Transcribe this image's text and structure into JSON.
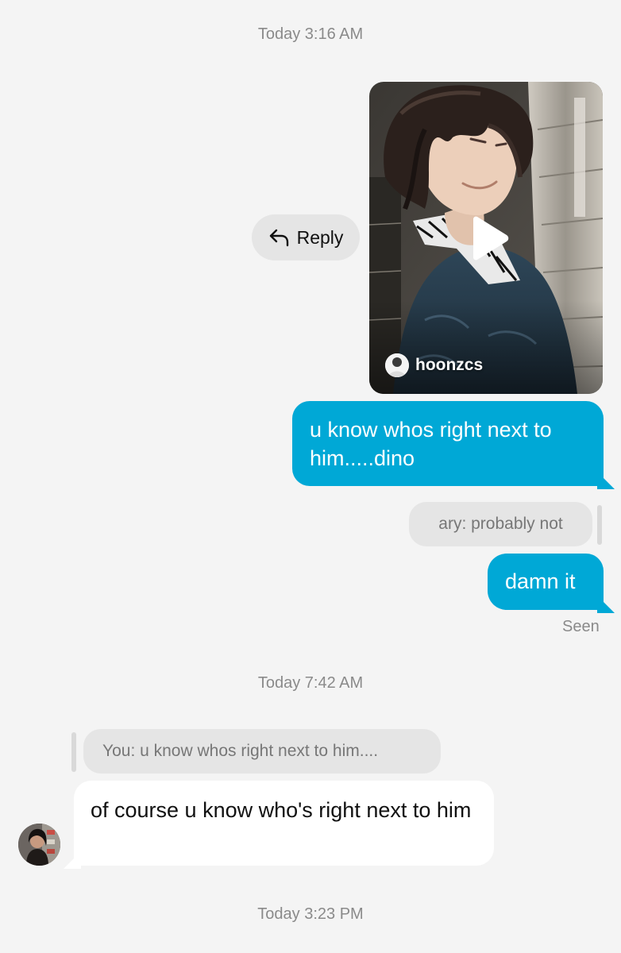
{
  "thread": {
    "timestamps": [
      "Today 3:16 AM",
      "Today 7:42 AM",
      "Today 3:23 PM"
    ],
    "reply_button": {
      "label": "Reply",
      "icon": "reply-arrow-icon"
    },
    "shared_reel": {
      "username": "hoonzcs",
      "play_icon": "play-icon"
    },
    "messages": [
      {
        "from": "me",
        "text": "u know whos right next to him.....dino"
      },
      {
        "from": "me",
        "quoted_reply": "ary: probably not",
        "text": "damn it"
      },
      {
        "from": "them",
        "quoted_reply": "You: u know whos right next to him....",
        "text": "of course u know who's right next to him"
      }
    ],
    "seen_label": "Seen"
  },
  "colors": {
    "background": "#f4f4f4",
    "outgoing_bubble": "#00a8d6",
    "incoming_bubble": "#ffffff",
    "quote_bubble": "#e5e5e5",
    "timestamp_text": "#8a8a8a"
  }
}
